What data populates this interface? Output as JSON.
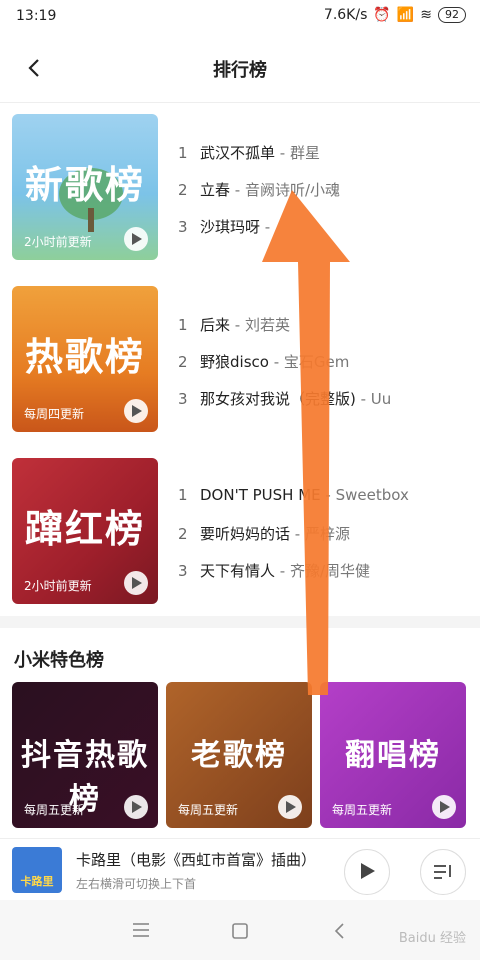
{
  "status": {
    "time": "13:19",
    "speed": "7.6K/s",
    "battery": "92"
  },
  "header": {
    "title": "排行榜"
  },
  "charts": [
    {
      "cover_title": "新歌榜",
      "updated": "2小时前更新",
      "tracks": [
        {
          "num": "1",
          "song": "武汉不孤单",
          "artist": " - 群星"
        },
        {
          "num": "2",
          "song": "立春",
          "artist": " - 音阙诗听/小魂"
        },
        {
          "num": "3",
          "song": "沙琪玛呀",
          "artist": " - "
        }
      ]
    },
    {
      "cover_title": "热歌榜",
      "updated": "每周四更新",
      "tracks": [
        {
          "num": "1",
          "song": "后来",
          "artist": " - 刘若英"
        },
        {
          "num": "2",
          "song": "野狼disco",
          "artist": " - 宝石Gem"
        },
        {
          "num": "3",
          "song": "那女孩对我说（完整版)",
          "artist": " - Uu"
        }
      ]
    },
    {
      "cover_title": "蹿红榜",
      "updated": "2小时前更新",
      "tracks": [
        {
          "num": "1",
          "song": "DON'T PUSH ME",
          "artist": " - Sweetbox"
        },
        {
          "num": "2",
          "song": "要听妈妈的话",
          "artist": " - 严梓源"
        },
        {
          "num": "3",
          "song": "天下有情人",
          "artist": " - 齐豫/周华健"
        }
      ]
    }
  ],
  "section": {
    "title": "小米特色榜"
  },
  "special": [
    {
      "title": "抖音热歌榜",
      "updated": "每周五更新"
    },
    {
      "title": "老歌榜",
      "updated": "每周五更新"
    },
    {
      "title": "翻唱榜",
      "updated": "每周五更新"
    }
  ],
  "player": {
    "title": "卡路里（电影《西虹市首富》插曲）",
    "subtitle": "左右横滑可切换上下首",
    "cover_text": "卡路里"
  },
  "watermark": "Baidu 经验"
}
